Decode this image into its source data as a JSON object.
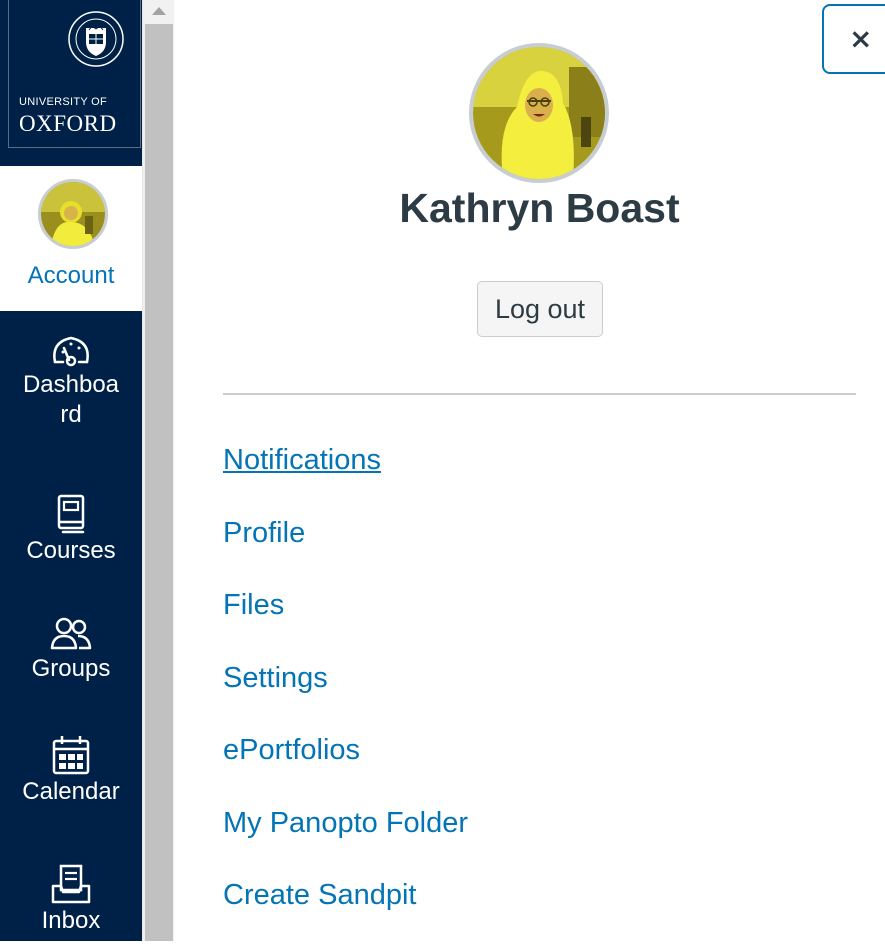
{
  "logo": {
    "line1": "UNIVERSITY OF",
    "line2": "OXFORD"
  },
  "nav": {
    "account": "Account",
    "dashboard": "Dashboa\nrd",
    "courses": "Courses",
    "groups": "Groups",
    "calendar": "Calendar",
    "inbox": "Inbox"
  },
  "tray": {
    "close_label": "×",
    "user_name": "Kathryn Boast",
    "logout_label": "Log out",
    "links": [
      "Notifications",
      "Profile",
      "Files",
      "Settings",
      "ePortfolios",
      "My Panopto Folder",
      "Create Sandpit"
    ]
  },
  "colors": {
    "nav_bg": "#002147",
    "link": "#0374b5",
    "text": "#2d3b45",
    "border": "#c7cdd1"
  }
}
